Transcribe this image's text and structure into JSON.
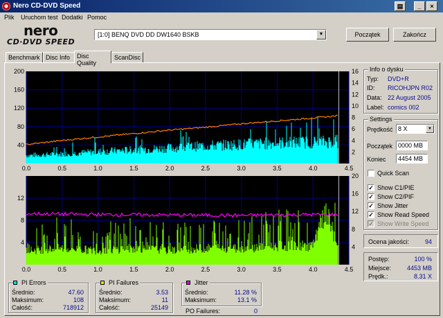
{
  "window": {
    "title": "Nero CD-DVD Speed"
  },
  "menu": [
    "Plik",
    "Uruchom test",
    "Dodatki",
    "Pomoc"
  ],
  "logo": {
    "brand": "nero",
    "product": "CD·DVD SPEED"
  },
  "drive": {
    "selected": "[1:0]   BENQ DVD DD DW1640 BSKB"
  },
  "buttons": {
    "start": "Początek",
    "exit": "Zakończ"
  },
  "tabs": [
    {
      "label": "Benchmark",
      "active": false
    },
    {
      "label": "Disc Info",
      "active": false
    },
    {
      "label": "Disc Quality",
      "active": true
    },
    {
      "label": "ScanDisc",
      "active": false
    }
  ],
  "info": {
    "title": "Info o dysku",
    "type_label": "Typ:",
    "type": "DVD+R",
    "id_label": "ID:",
    "id": "RICOHJPN R02",
    "date_label": "Data:",
    "date": "22 August 2005",
    "label_label": "Label:",
    "label": "comics 002"
  },
  "settings": {
    "title": "Settings",
    "speed_label": "Prędkość",
    "speed": "8 X",
    "start_label": "Początek",
    "start": "0000 MB",
    "end_label": "Koniec",
    "end": "4454 MB",
    "quick_scan": {
      "label": "Quick Scan",
      "checked": false
    },
    "show_c1": {
      "label": "Show C1/PIE",
      "checked": true
    },
    "show_c2": {
      "label": "Show C2/PIF",
      "checked": true
    },
    "show_jitter": {
      "label": "Show Jitter",
      "checked": true
    },
    "show_read": {
      "label": "Show Read Speed",
      "checked": true
    },
    "show_write": {
      "label": "Show Write Speed",
      "checked": true,
      "disabled": true
    }
  },
  "quality": {
    "label": "Ocena jakości:",
    "value": "94"
  },
  "progress": {
    "progress_label": "Postęp:",
    "progress": "100 %",
    "position_label": "Miejsce:",
    "position": "4453 MB",
    "speed_label": "Prędk.:",
    "speed": "8.31 X"
  },
  "pi_errors": {
    "title": "PI Errors",
    "color": "#00e0e0",
    "avg_label": "Średnio:",
    "avg": "47.60",
    "max_label": "Maksimum:",
    "max": "108",
    "total_label": "Całość:",
    "total": "718912"
  },
  "pi_failures": {
    "title": "PI Failures",
    "color": "#e8e800",
    "avg_label": "Średnio:",
    "avg": "3.53",
    "max_label": "Maksimum:",
    "max": "11",
    "total_label": "Całość:",
    "total": "25149"
  },
  "jitter": {
    "title": "Jitter",
    "color": "#e000e0",
    "avg_label": "Średnio:",
    "avg": "11.28 %",
    "max_label": "Maksimum:",
    "max": "13.1 %"
  },
  "po_failures": {
    "label": "PO Failures:",
    "value": "0"
  },
  "chart_data": [
    {
      "type": "area",
      "x_ticks": [
        "0.0",
        "0.5",
        "1.0",
        "1.5",
        "2.0",
        "2.5",
        "3.0",
        "3.5",
        "4.0",
        "4.5"
      ],
      "y_left_ticks": [
        "200",
        "160",
        "120",
        "80",
        "40"
      ],
      "y_right_ticks": [
        "16",
        "14",
        "12",
        "10",
        "8",
        "6",
        "4",
        "2"
      ],
      "xlim": [
        0,
        4.5
      ],
      "ylim": [
        0,
        200
      ],
      "y2lim": [
        0,
        16
      ],
      "grid": true,
      "series": [
        {
          "color": "#00ffff",
          "x": [
            0,
            0.5,
            1.0,
            1.5,
            2.0,
            2.5,
            3.0,
            3.5,
            4.0,
            4.35
          ],
          "values": [
            22,
            26,
            32,
            37,
            42,
            48,
            52,
            56,
            58,
            60
          ]
        },
        {
          "color": "#ff8000",
          "axis": "right",
          "x": [
            0,
            0.5,
            1.0,
            1.5,
            2.0,
            2.5,
            3.0,
            3.5,
            4.0,
            4.35
          ],
          "values": [
            3.3,
            4.0,
            4.6,
            5.2,
            5.8,
            6.3,
            6.9,
            7.4,
            7.9,
            8.3
          ]
        }
      ]
    },
    {
      "type": "bar",
      "x_ticks": [
        "0.0",
        "0.5",
        "1.0",
        "1.5",
        "2.0",
        "2.5",
        "3.0",
        "3.5",
        "4.0",
        "4.5"
      ],
      "y_left_ticks": [
        "12",
        "8",
        "4"
      ],
      "y_right_ticks": [
        "20",
        "16",
        "12",
        "8",
        "4"
      ],
      "xlim": [
        0,
        4.5
      ],
      "ylim": [
        0,
        16
      ],
      "y2lim": [
        0,
        20
      ],
      "grid": true,
      "series": [
        {
          "color": "#80ff00",
          "x": [
            0,
            0.5,
            1.0,
            1.5,
            2.0,
            2.5,
            3.0,
            3.5,
            4.0,
            4.1,
            4.2,
            4.35
          ],
          "values": [
            3,
            3.5,
            3,
            3.5,
            3,
            3.5,
            3.5,
            4,
            4,
            8,
            11,
            3
          ]
        },
        {
          "color": "#ff00ff",
          "axis": "right",
          "x": [
            0,
            1.0,
            2.0,
            3.0,
            4.0,
            4.35
          ],
          "values": [
            11.5,
            11.3,
            11.2,
            11.1,
            11.3,
            11.3
          ]
        }
      ]
    }
  ]
}
